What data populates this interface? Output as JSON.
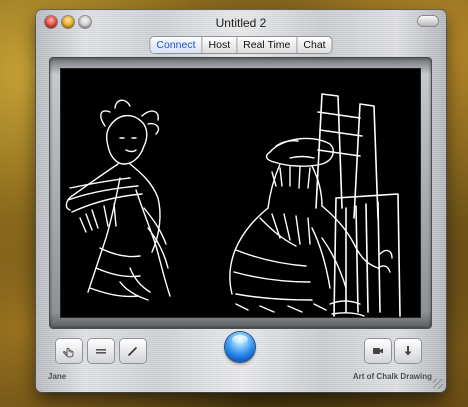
{
  "window": {
    "title": "Untitled 2"
  },
  "tabs": [
    {
      "label": "Connect",
      "active": true
    },
    {
      "label": "Host",
      "active": false
    },
    {
      "label": "Real Time",
      "active": false
    },
    {
      "label": "Chat",
      "active": false
    }
  ],
  "toolbar": {
    "left_buttons": [
      "pointer-hand-icon",
      "lines-icon",
      "pen-icon"
    ],
    "center_button": "blue-orb-icon",
    "right_buttons": [
      "camera-icon",
      "download-arrow-icon"
    ]
  },
  "status": {
    "left": "Jane",
    "right": "Art of Chalk Drawing"
  },
  "colors": {
    "accent": "#1a4fd6",
    "canvas": "#000000",
    "chalk": "#ffffff"
  }
}
